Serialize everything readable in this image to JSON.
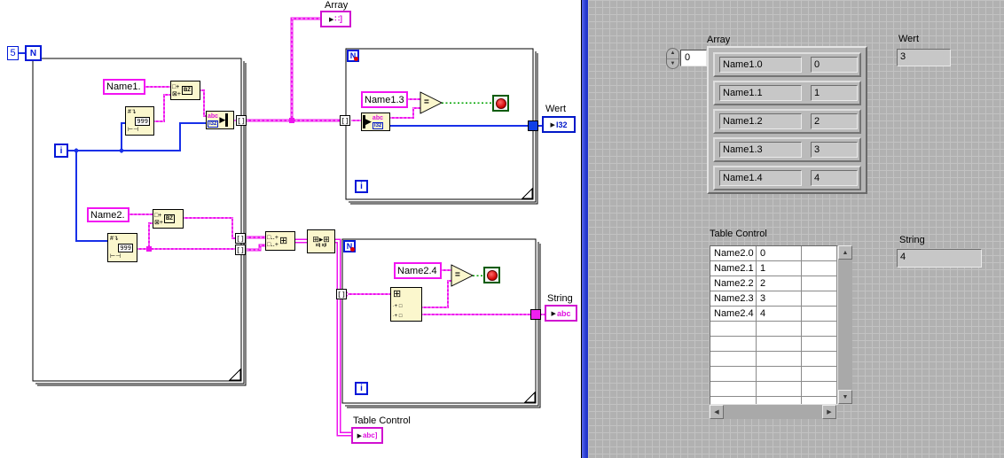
{
  "diagram": {
    "labels": {
      "array": "Array",
      "wert": "Wert",
      "string": "String",
      "table": "Table Control"
    },
    "constants": {
      "count": "5",
      "name1": "Name1.",
      "name2": "Name2.",
      "name1_3": "Name1.3",
      "name2_4": "Name2.4"
    },
    "terminals": {
      "count": "N",
      "iteration": "i",
      "loop_cond": "N",
      "arrow": "▶",
      "wert_type": "I32",
      "string_type": "abc",
      "table_type": "abc]",
      "array_glyph": "∷]",
      "tunnel": "[]"
    },
    "glyphs": {
      "hash": "#",
      "bend_arrow": "↴",
      "num_fmt": "999",
      "width": "⊢⊣",
      "concat_a": "□+",
      "concat_b": "⊠+",
      "concat_r": "BZ",
      "abc": "abc",
      "i32": "I32",
      "bar_arrow": "▶",
      "build_row": "□‥+",
      "grid": "⊞",
      "small_arrow": "▸",
      "xij": "xij",
      "xji": "xji",
      "eq": "=",
      "idx_row": "∙+ □"
    }
  },
  "panel": {
    "array": {
      "label": "Array",
      "index_value": "0",
      "rows": [
        {
          "name": "Name1.0",
          "value": "0"
        },
        {
          "name": "Name1.1",
          "value": "1"
        },
        {
          "name": "Name1.2",
          "value": "2"
        },
        {
          "name": "Name1.3",
          "value": "3"
        },
        {
          "name": "Name1.4",
          "value": "4"
        }
      ]
    },
    "wert": {
      "label": "Wert",
      "value": "3"
    },
    "string": {
      "label": "String",
      "value": "4"
    },
    "table": {
      "label": "Table Control",
      "visible_rows": 11,
      "rows": [
        [
          "Name2.0",
          "0",
          ""
        ],
        [
          "Name2.1",
          "1",
          ""
        ],
        [
          "Name2.2",
          "2",
          ""
        ],
        [
          "Name2.3",
          "3",
          ""
        ],
        [
          "Name2.4",
          "4",
          ""
        ]
      ]
    },
    "spinner": {
      "up": "▲",
      "down": "▼"
    },
    "scroll": {
      "up": "▲",
      "down": "▼",
      "left": "◀",
      "right": "▶"
    }
  },
  "colors": {
    "wire_string": "#ee12ee",
    "wire_int": "#1830e8",
    "wire_bool": "#00a400",
    "icon_bg": "#fbf7cd",
    "panel_bg": "#b1b1b1",
    "divider": "#2336cc"
  }
}
